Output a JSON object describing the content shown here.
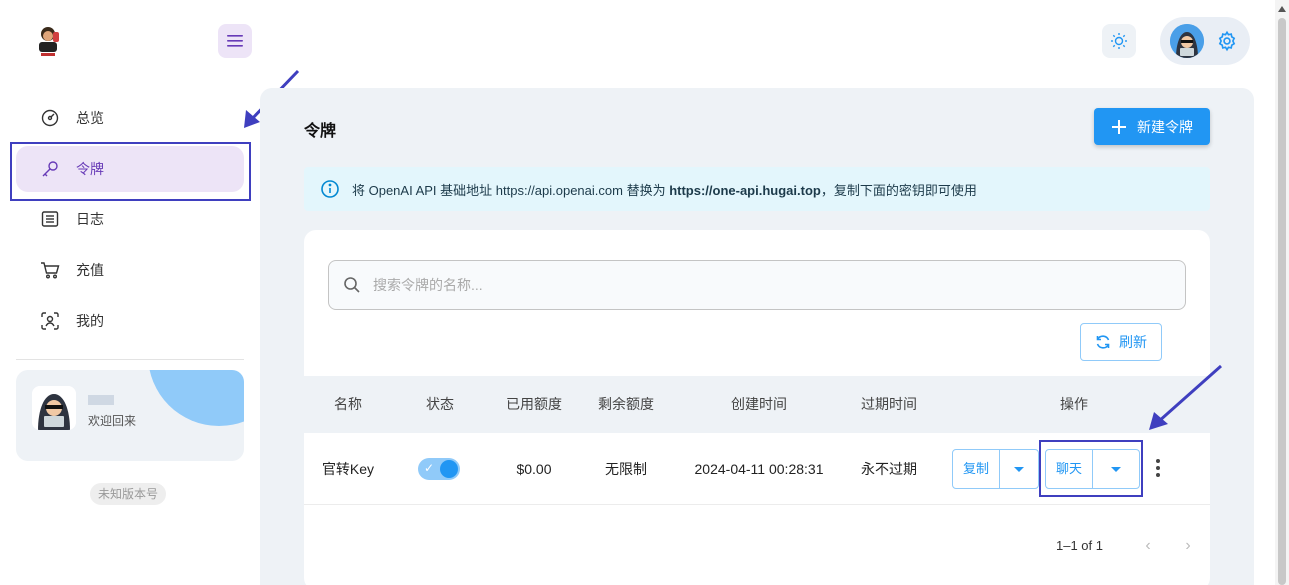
{
  "sidebar": {
    "items": [
      {
        "label": "总览",
        "icon": "dashboard-icon"
      },
      {
        "label": "令牌",
        "icon": "key-icon",
        "active": true
      },
      {
        "label": "日志",
        "icon": "article-icon"
      },
      {
        "label": "充值",
        "icon": "cart-icon"
      },
      {
        "label": "我的",
        "icon": "user-scan-icon"
      }
    ],
    "user_card": {
      "welcome": "欢迎回来"
    },
    "version": "未知版本号"
  },
  "header": {
    "menu_icon": "menu-icon",
    "theme_icon": "sun-icon",
    "settings_icon": "gear-icon"
  },
  "page": {
    "title": "令牌",
    "new_button": "新建令牌",
    "info": {
      "prefix": "将 OpenAI API 基础地址 https://api.openai.com 替换为 ",
      "bold": "https://one-api.hugai.top",
      "suffix": "，复制下面的密钥即可使用"
    },
    "search": {
      "placeholder": "搜索令牌的名称..."
    },
    "refresh_button": "刷新"
  },
  "table": {
    "headers": [
      "名称",
      "状态",
      "已用额度",
      "剩余额度",
      "创建时间",
      "过期时间",
      "操作"
    ],
    "rows": [
      {
        "name": "官转Key",
        "enabled": true,
        "used": "$0.00",
        "remaining": "无限制",
        "created": "2024-04-11 00:28:31",
        "expires": "永不过期",
        "copy_label": "复制",
        "chat_label": "聊天"
      }
    ]
  },
  "pagination": {
    "range": "1–1 of 1"
  },
  "colors": {
    "accent": "#2196f3",
    "active_bg": "#ede4f7",
    "active_text": "#673ab7",
    "annotation": "#3f3fbf"
  }
}
